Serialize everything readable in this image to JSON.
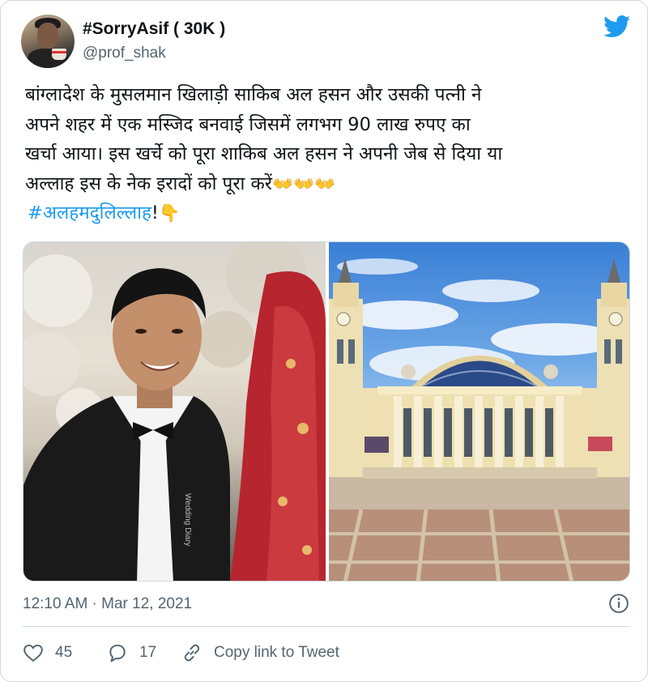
{
  "author": {
    "display_name": "#SorryAsif ( 30K )",
    "username": "@prof_shak"
  },
  "tweet": {
    "text_lines": [
      "बांग्लादेश के मुसलमान खिलाड़ी साकिब अल हसन और उसकी पत्नी ने",
      "अपने शहर में एक मस्जिद बनवाई जिसमें लगभग 90 लाख रुपए का",
      "खर्चा आया। इस खर्चे को पूरा शाकिब अल हसन ने अपनी जेब से दिया या",
      "अल्लाह इस के नेक इरादों को पूरा करें"
    ],
    "prayer_emojis": "👐👐👐",
    "hashtag": "#अलहमदुलिल्लाह",
    "hashtag_suffix": "!",
    "pointing_emoji": "👇"
  },
  "media": {
    "left_watermark": "Wedding Diary"
  },
  "timestamp": "12:10 AM · Mar 12, 2021",
  "actions": {
    "likes": "45",
    "replies": "17",
    "copy_link_label": "Copy link to Tweet"
  },
  "icons": {
    "brand": "twitter-bird-icon",
    "info": "info-icon",
    "like": "heart-icon",
    "reply": "comment-icon",
    "link": "link-icon"
  },
  "colors": {
    "brand_blue": "#1d9bf0",
    "text_primary": "#0f1419",
    "text_secondary": "#536471",
    "border": "#cfd9de"
  }
}
